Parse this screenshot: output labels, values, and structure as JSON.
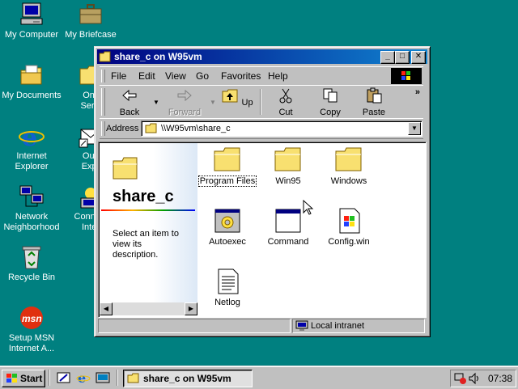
{
  "desktop": {
    "icons": [
      {
        "label": "My Computer",
        "icon": "my-computer-icon"
      },
      {
        "label": "My Briefcase",
        "icon": "briefcase-icon"
      },
      {
        "label": "My Documents",
        "icon": "my-documents-icon"
      },
      {
        "label": "Onli\nServi",
        "icon": "online-services-icon"
      },
      {
        "label": "Internet\nExplorer",
        "icon": "internet-explorer-icon"
      },
      {
        "label": "Outl\nExpr",
        "icon": "outlook-express-icon"
      },
      {
        "label": "Network\nNeighborhood",
        "icon": "network-neighborhood-icon"
      },
      {
        "label": "Connect\nInter",
        "icon": "connect-internet-icon"
      },
      {
        "label": "Recycle Bin",
        "icon": "recycle-bin-icon"
      },
      {
        "label": "Setup MSN\nInternet A...",
        "icon": "msn-icon"
      }
    ]
  },
  "window": {
    "title": "share_c on W95vm",
    "menu": [
      "File",
      "Edit",
      "View",
      "Go",
      "Favorites",
      "Help"
    ],
    "toolbar": {
      "back": "Back",
      "forward": "Forward",
      "up": "Up",
      "cut": "Cut",
      "copy": "Copy",
      "paste": "Paste",
      "more": "»"
    },
    "address_label": "Address",
    "address_value": "\\\\W95vm\\share_c",
    "webview": {
      "title": "share_c",
      "description": "Select an item to view its description."
    },
    "items": [
      {
        "label": "Program Files",
        "icon": "folder-icon"
      },
      {
        "label": "Win95",
        "icon": "folder-icon"
      },
      {
        "label": "Windows",
        "icon": "folder-icon"
      },
      {
        "label": "Autoexec",
        "icon": "batch-file-icon"
      },
      {
        "label": "Command",
        "icon": "ms-dos-program-icon"
      },
      {
        "label": "Config.win",
        "icon": "config-file-icon"
      },
      {
        "label": "Netlog",
        "icon": "text-document-icon"
      }
    ],
    "status": {
      "zone": "Local intranet"
    }
  },
  "taskbar": {
    "start": "Start",
    "task": "share_c on W95vm",
    "clock": "07:38"
  },
  "colors": {
    "desktop": "#008080",
    "titlebar": "#000080",
    "face": "#c0c0c0"
  }
}
